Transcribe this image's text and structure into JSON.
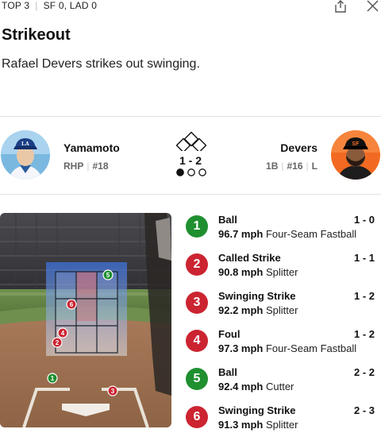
{
  "header": {
    "inning": "TOP 3",
    "score": "SF 0, LAD 0",
    "share_icon": "share-icon",
    "close_icon": "close-icon"
  },
  "play": {
    "title": "Strikeout",
    "description": "Rafael Devers strikes out swinging."
  },
  "matchup": {
    "pitcher": {
      "name": "Yamamoto",
      "position": "RHP",
      "number": "#18",
      "team_color": "#005A9C"
    },
    "batter": {
      "name": "Devers",
      "position": "1B",
      "number": "#16",
      "bats": "L",
      "team_color": "#FD5A1E"
    },
    "count": "1 - 2",
    "outs": 1,
    "outs_max": 3,
    "bases_occupied": [
      false,
      false,
      false
    ]
  },
  "colors": {
    "ball": "#1f8f2f",
    "strike": "#cc2431"
  },
  "pitches": [
    {
      "number": "1",
      "result": "Ball",
      "count": "1 - 0",
      "speed": "96.7 mph",
      "pitch_type": "Four-Seam Fastball",
      "kind": "ball"
    },
    {
      "number": "2",
      "result": "Called Strike",
      "count": "1 - 1",
      "speed": "90.8 mph",
      "pitch_type": "Splitter",
      "kind": "strike"
    },
    {
      "number": "3",
      "result": "Swinging Strike",
      "count": "1 - 2",
      "speed": "92.2 mph",
      "pitch_type": "Splitter",
      "kind": "strike"
    },
    {
      "number": "4",
      "result": "Foul",
      "count": "1 - 2",
      "speed": "97.3 mph",
      "pitch_type": "Four-Seam Fastball",
      "kind": "strike"
    },
    {
      "number": "5",
      "result": "Ball",
      "count": "2 - 2",
      "speed": "92.4 mph",
      "pitch_type": "Cutter",
      "kind": "ball"
    },
    {
      "number": "6",
      "result": "Swinging Strike",
      "count": "2 - 3",
      "speed": "91.3 mph",
      "pitch_type": "Splitter",
      "kind": "strike"
    }
  ]
}
